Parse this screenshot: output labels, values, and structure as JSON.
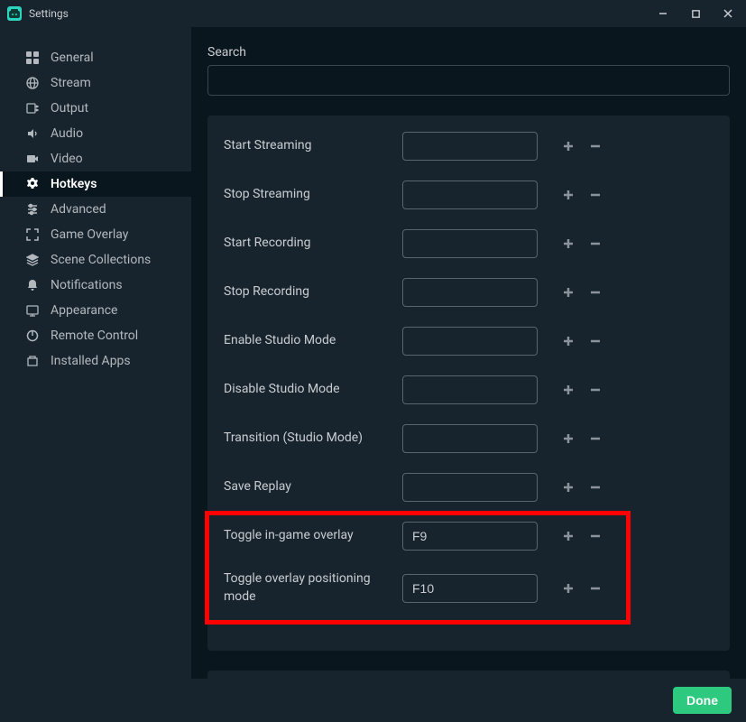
{
  "titlebar": {
    "title": "Settings"
  },
  "sidebar": {
    "items": [
      {
        "label": "General"
      },
      {
        "label": "Stream"
      },
      {
        "label": "Output"
      },
      {
        "label": "Audio"
      },
      {
        "label": "Video"
      },
      {
        "label": "Hotkeys"
      },
      {
        "label": "Advanced"
      },
      {
        "label": "Game Overlay"
      },
      {
        "label": "Scene Collections"
      },
      {
        "label": "Notifications"
      },
      {
        "label": "Appearance"
      },
      {
        "label": "Remote Control"
      },
      {
        "label": "Installed Apps"
      }
    ]
  },
  "search": {
    "label": "Search",
    "value": ""
  },
  "hotkeys": [
    {
      "label": "Start Streaming",
      "value": ""
    },
    {
      "label": "Stop Streaming",
      "value": ""
    },
    {
      "label": "Start Recording",
      "value": ""
    },
    {
      "label": "Stop Recording",
      "value": ""
    },
    {
      "label": "Enable Studio Mode",
      "value": ""
    },
    {
      "label": "Disable Studio Mode",
      "value": ""
    },
    {
      "label": "Transition (Studio Mode)",
      "value": ""
    },
    {
      "label": "Save Replay",
      "value": ""
    },
    {
      "label": "Toggle in-game overlay",
      "value": "F9"
    },
    {
      "label": "Toggle overlay positioning mode",
      "value": "F10"
    }
  ],
  "footer": {
    "done": "Done"
  }
}
